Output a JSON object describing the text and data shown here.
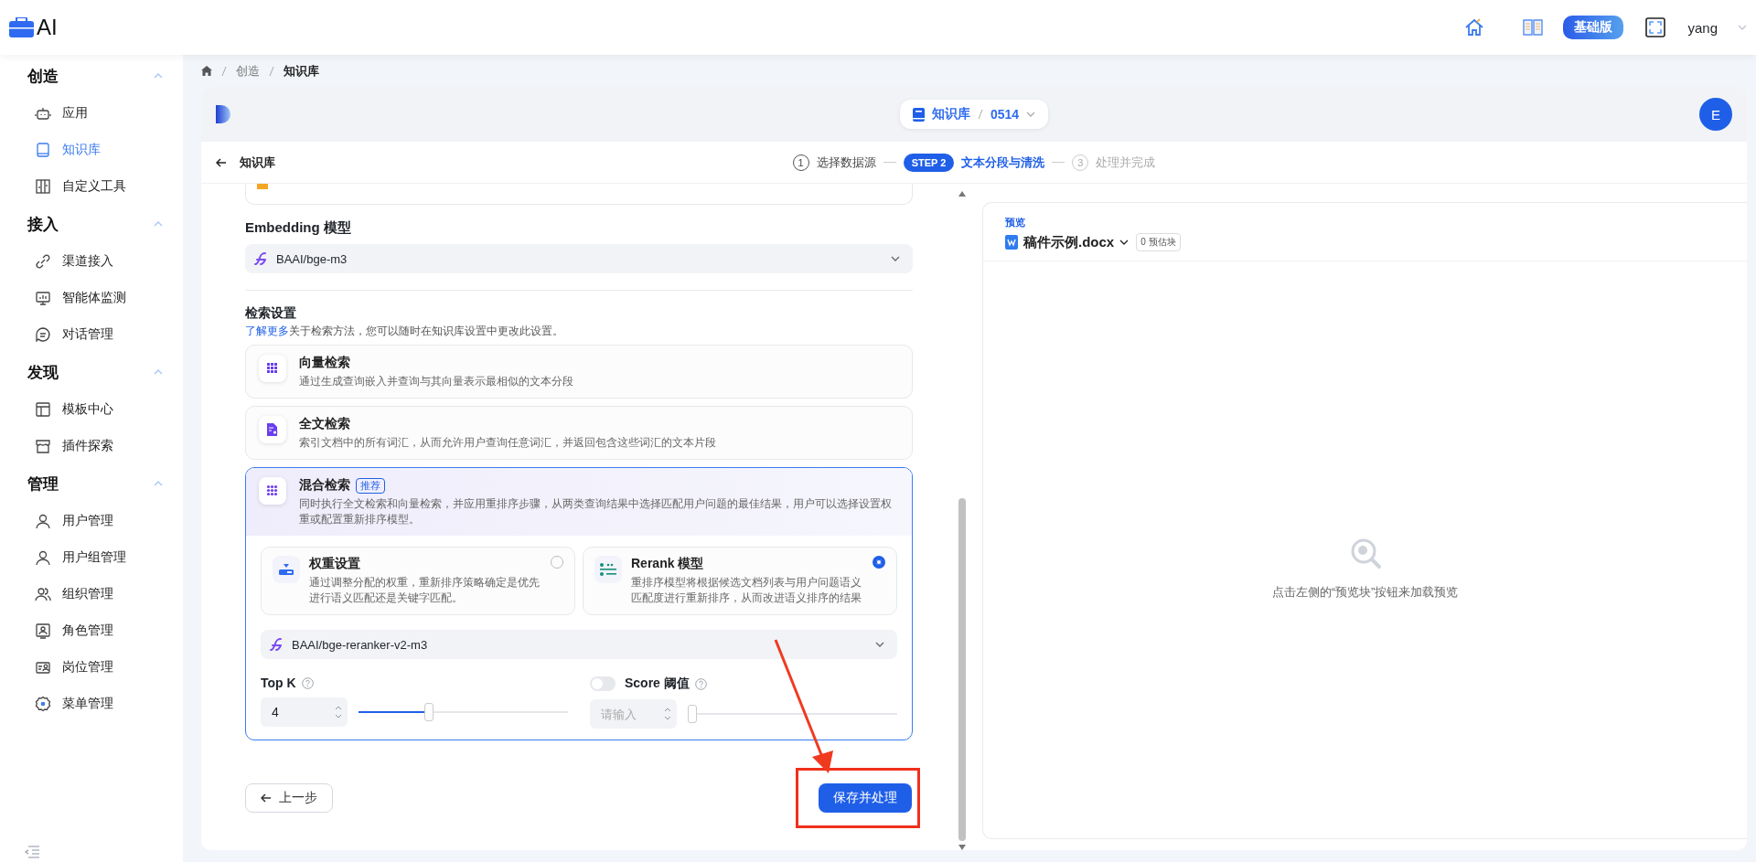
{
  "app": {
    "title": "AI"
  },
  "header": {
    "plan_badge": "基础版",
    "user": "yang"
  },
  "sidebar": {
    "groups": [
      {
        "title": "创造",
        "expanded": true,
        "items": [
          {
            "label": "应用",
            "selected": false
          },
          {
            "label": "知识库",
            "selected": true
          },
          {
            "label": "自定义工具",
            "selected": false
          }
        ]
      },
      {
        "title": "接入",
        "expanded": true,
        "items": [
          {
            "label": "渠道接入",
            "selected": false
          },
          {
            "label": "智能体监测",
            "selected": false
          },
          {
            "label": "对话管理",
            "selected": false
          }
        ]
      },
      {
        "title": "发现",
        "expanded": true,
        "items": [
          {
            "label": "模板中心",
            "selected": false
          },
          {
            "label": "插件探索",
            "selected": false
          }
        ]
      },
      {
        "title": "管理",
        "expanded": true,
        "items": [
          {
            "label": "用户管理",
            "selected": false
          },
          {
            "label": "用户组管理",
            "selected": false
          },
          {
            "label": "组织管理",
            "selected": false
          },
          {
            "label": "角色管理",
            "selected": false
          },
          {
            "label": "岗位管理",
            "selected": false
          },
          {
            "label": "菜单管理",
            "selected": false
          }
        ]
      }
    ]
  },
  "breadcrumb": [
    "创造",
    "知识库"
  ],
  "workspace": {
    "section": "知识库",
    "name": "0514",
    "avatar": "E"
  },
  "page": {
    "back_label": "知识库",
    "steps": [
      {
        "marker": "1",
        "label": "选择数据源",
        "completed": true,
        "active": false
      },
      {
        "marker": "STEP 2",
        "label": "文本分段与清洗",
        "completed": false,
        "active": true
      },
      {
        "marker": "3",
        "label": "处理并完成",
        "completed": false,
        "active": false
      }
    ]
  },
  "embedding": {
    "label": "Embedding 模型",
    "value": "BAAI/bge-m3"
  },
  "retrieval": {
    "title": "检索设置",
    "link": "了解更多",
    "note": "关于检索方法，您可以随时在知识库设置中更改此设置。",
    "methods": [
      {
        "kind": "vector",
        "title": "向量检索",
        "description": "通过生成查询嵌入并查询与其向量表示最相似的文本分段",
        "selected": false
      },
      {
        "kind": "fulltext",
        "title": "全文检索",
        "description": "索引文档中的所有词汇，从而允许用户查询任意词汇，并返回包含这些词汇的文本片段",
        "selected": false
      },
      {
        "kind": "hybrid",
        "title": "混合检索",
        "badge": "推荐",
        "description": "同时执行全文检索和向量检索，并应用重排序步骤，从两类查询结果中选择匹配用户问题的最佳结果，用户可以选择设置权重或配置重新排序模型。",
        "selected": true
      }
    ],
    "rerank_options": [
      {
        "kind": "weight",
        "title": "权重设置",
        "description": "通过调整分配的权重，重新排序策略确定是优先进行语义匹配还是关键字匹配。",
        "selected": false
      },
      {
        "kind": "rerank",
        "title": "Rerank 模型",
        "description": "重排序模型将根据候选文档列表与用户问题语义匹配度进行重新排序，从而改进语义排序的结果",
        "selected": true
      }
    ],
    "rerank_model": "BAAI/bge-reranker-v2-m3",
    "top_k": {
      "label": "Top K",
      "value": "4",
      "level": 0.33
    },
    "score": {
      "label": "Score 阈值",
      "enabled": false,
      "placeholder": "请输入",
      "level": 0
    }
  },
  "actions": {
    "back": "上一步",
    "submit": "保存并处理"
  },
  "preview": {
    "label": "预览",
    "file": "稿件示例.docx",
    "chunk_badge": "0 预估块",
    "empty_message": "点击左侧的“预览块”按钮来加载预览"
  }
}
